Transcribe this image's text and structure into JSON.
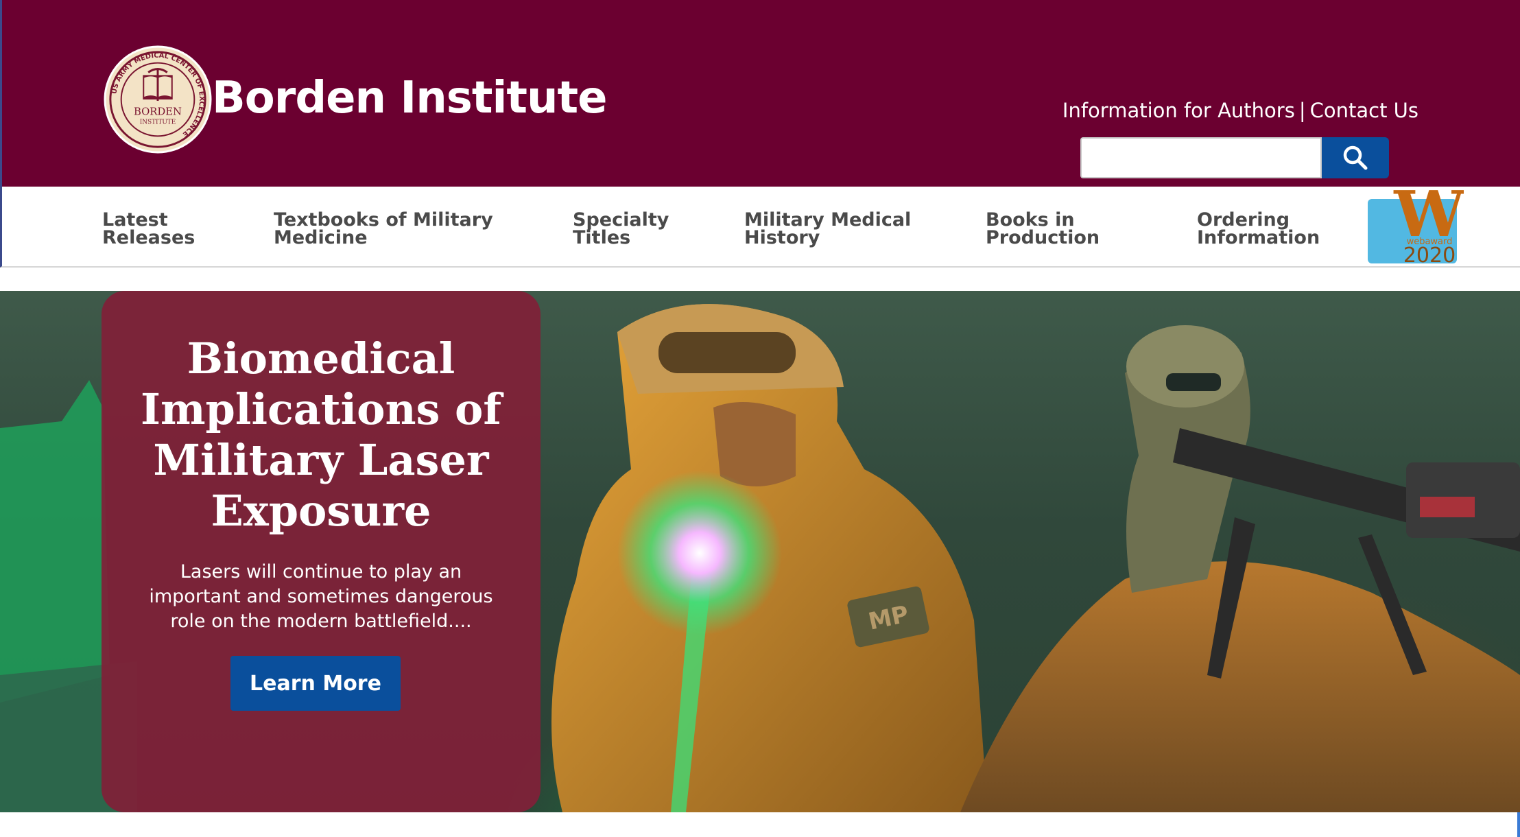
{
  "header": {
    "site_title": "Borden Institute",
    "seal": {
      "ring_text": "US ARMY MEDICAL CENTER OF EXCELLENCE",
      "name": "BORDEN",
      "subname": "INSTITUTE"
    },
    "utility_links": [
      "Information for Authors",
      "Contact Us"
    ],
    "separator": "|",
    "search": {
      "placeholder": "",
      "value": "",
      "icon": "search-icon"
    }
  },
  "nav": {
    "items": [
      {
        "line1": "Latest",
        "line2": "Releases"
      },
      {
        "line1": "Textbooks of Military",
        "line2": "Medicine"
      },
      {
        "line1": "Specialty",
        "line2": "Titles"
      },
      {
        "line1": "Military Medical",
        "line2": "History"
      },
      {
        "line1": "Books in",
        "line2": "Production"
      },
      {
        "line1": "Ordering",
        "line2": "Information"
      }
    ],
    "badge": {
      "letter": "W",
      "label": "webaward",
      "year": "2020"
    }
  },
  "hero": {
    "title": "Biomedical Implications of Military Laser Exposure",
    "text": "Lasers will continue to play an important and sometimes dangerous role on the modern battlefield....",
    "button_label": "Learn More",
    "patch_text": "MP"
  },
  "colors": {
    "header_bg": "#6b0030",
    "card_bg": "#802038",
    "button_blue": "#0a4f9c",
    "nav_text": "#4a4a4a"
  }
}
